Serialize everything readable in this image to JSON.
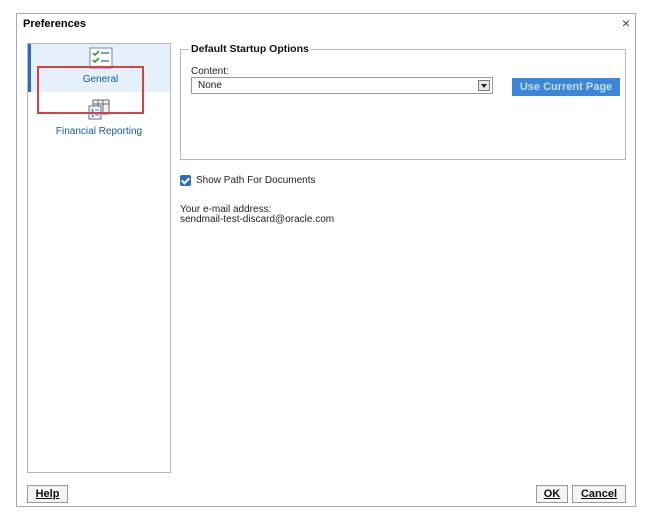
{
  "dialog": {
    "title": "Preferences",
    "close_glyph": "×"
  },
  "nav": {
    "items": [
      {
        "label": "General",
        "icon": "checklist-icon",
        "selected": true
      },
      {
        "label": "Financial Reporting",
        "icon": "report-grid-icon",
        "selected": false
      }
    ]
  },
  "startup": {
    "legend": "Default Startup Options",
    "content_label": "Content:",
    "content_value": "None",
    "use_current_page_label": "Use Current Page"
  },
  "show_path": {
    "label": "Show Path For Documents",
    "checked": true
  },
  "email": {
    "label": "Your e-mail address:",
    "value": "sendmail-test-discard@oracle.com"
  },
  "buttons": {
    "help": "Help",
    "ok": "OK",
    "cancel": "Cancel"
  },
  "colors": {
    "accent": "#2a70c2",
    "highlight": "#d9414a",
    "button_disabled": "#3b86d6"
  }
}
